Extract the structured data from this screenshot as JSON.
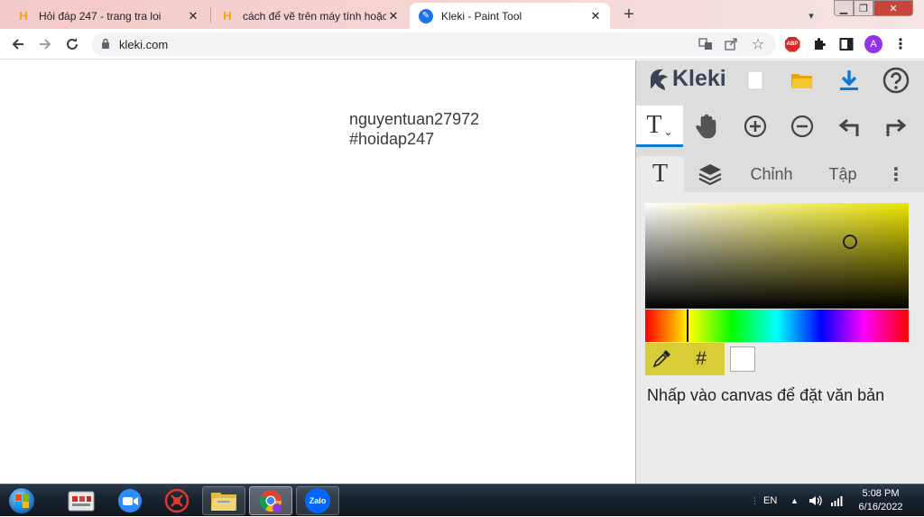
{
  "browser": {
    "tabs": [
      {
        "title": "Hỏi đáp 247 - trang tra loi",
        "favicon": "hoidap-favicon"
      },
      {
        "title": "cách để vẽ trên máy tính hoặc làm",
        "favicon": "hoidap-favicon"
      },
      {
        "title": "Kleki - Paint Tool",
        "favicon": "kleki-favicon",
        "active": true
      }
    ],
    "url": "kleki.com",
    "profile_initial": "A",
    "abp_label": "ABP"
  },
  "canvas": {
    "text_lines": [
      "nguyentuan27972",
      "#hoidap247"
    ]
  },
  "kleki": {
    "logo_text": "Kleki",
    "tool_glyph": "T",
    "tabs": {
      "text_tab_glyph": "T",
      "adjust_label": "Chỉnh",
      "file_label": "Tập"
    },
    "hex_label": "#",
    "hint": "Nhấp vào canvas để đặt văn bản",
    "colors": {
      "accent": "#0b7bd9",
      "hue_color": "#ece400",
      "picker_bg": "#d9cd37",
      "secondary_swatch": "#ffffff"
    }
  },
  "taskbar": {
    "language": "EN",
    "time": "5:08 PM",
    "date": "6/16/2022",
    "zalo_label": "Zalo"
  }
}
